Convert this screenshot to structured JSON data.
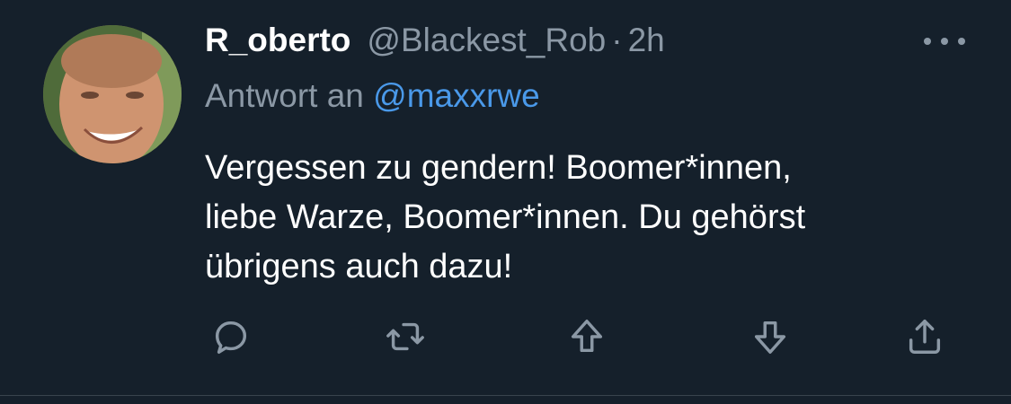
{
  "tweet": {
    "display_name": "R_oberto",
    "handle": "@Blackest_Rob",
    "separator": "·",
    "time": "2h",
    "reply_prefix": "Antwort an",
    "reply_mention": "@maxxrwe",
    "text_lines": [
      "Vergessen zu gendern! Boomer*innen,",
      "liebe Warze, Boomer*innen. Du gehörst",
      "übrigens auch dazu!"
    ]
  },
  "actions": [
    {
      "name": "reply",
      "icon": "reply-icon"
    },
    {
      "name": "retweet",
      "icon": "retweet-icon"
    },
    {
      "name": "upvote",
      "icon": "upvote-icon"
    },
    {
      "name": "downvote",
      "icon": "downvote-icon"
    },
    {
      "name": "share",
      "icon": "share-icon"
    }
  ],
  "colors": {
    "background": "#15202b",
    "text_primary": "#ffffff",
    "text_secondary": "#8b98a5",
    "link": "#4a99e9",
    "divider": "#38444d"
  }
}
